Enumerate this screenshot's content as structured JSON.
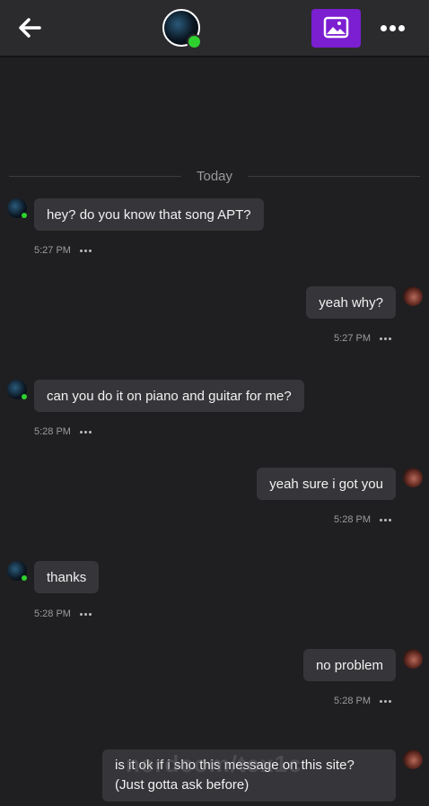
{
  "header": {
    "back_icon": "arrow-left-icon",
    "gallery_icon": "image-icon",
    "more_icon": "more-horizontal-icon",
    "accent_color": "#7b1fd0",
    "online_color": "#2ed12e"
  },
  "divider": {
    "label": "Today"
  },
  "messages": [
    {
      "sender": "them",
      "text": "hey? do you know that song APT?",
      "time": "5:27 PM"
    },
    {
      "sender": "me",
      "text": "yeah why?",
      "time": "5:27 PM"
    },
    {
      "sender": "them",
      "text": "can you do it on piano and guitar for me?",
      "time": "5:28 PM"
    },
    {
      "sender": "me",
      "text": "yeah sure i got you",
      "time": "5:28 PM"
    },
    {
      "sender": "them",
      "text": "thanks",
      "time": "5:28 PM"
    },
    {
      "sender": "me",
      "text": "no problem",
      "time": "5:28 PM"
    },
    {
      "sender": "me",
      "text": "is it ok if i sho this message on this site? (Just gotta ask before)",
      "time": ""
    }
  ],
  "watermark": {
    "text": "nerdcom/tex1c"
  }
}
